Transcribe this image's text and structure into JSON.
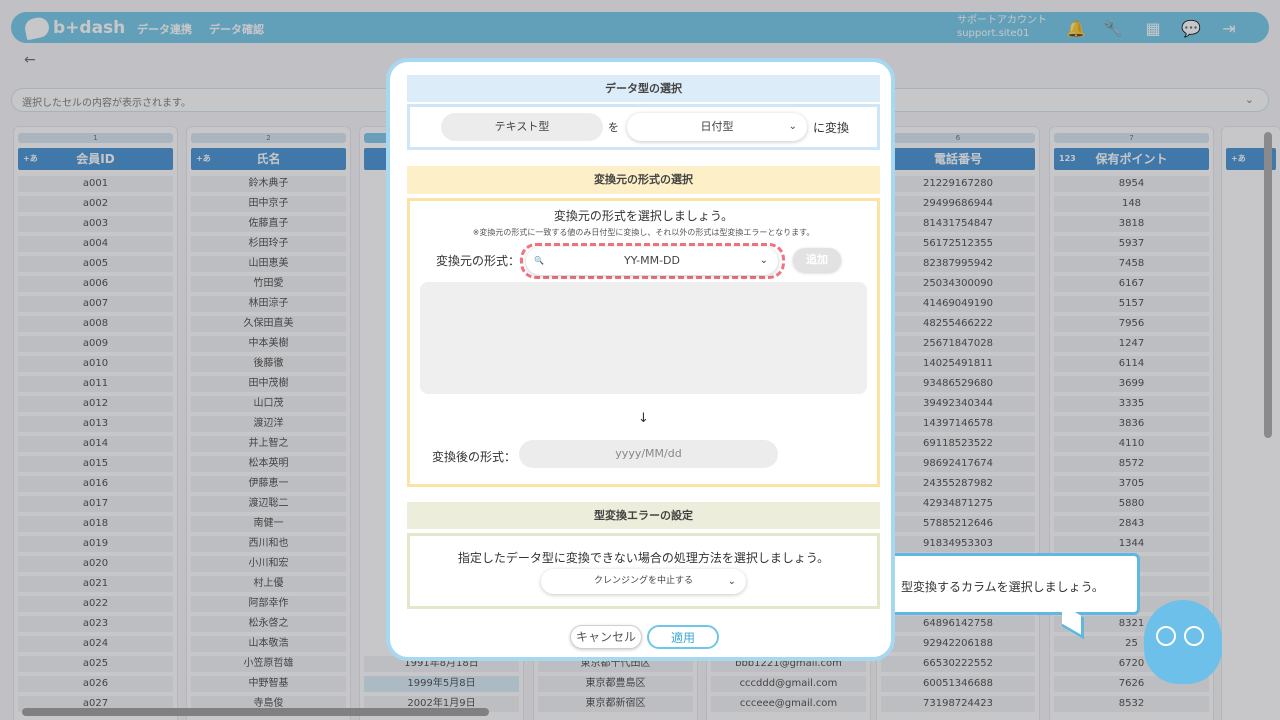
{
  "header": {
    "logo": "b+dash",
    "nav": [
      "データ連携",
      "データ確認"
    ],
    "account_name": "サポートアカウント",
    "account_id": "support.site01"
  },
  "selection_bar": {
    "placeholder": "選択したセルの内容が表示されます。"
  },
  "columns": [
    {
      "index": "1",
      "title": "会員ID",
      "type_icon": "+あ",
      "cells": [
        "a001",
        "a002",
        "a003",
        "a004",
        "a005",
        "a006",
        "a007",
        "a008",
        "a009",
        "a010",
        "a011",
        "a012",
        "a013",
        "a014",
        "a015",
        "a016",
        "a017",
        "a018",
        "a019",
        "a020",
        "a021",
        "a022",
        "a023",
        "a024",
        "a025",
        "a026",
        "a027"
      ]
    },
    {
      "index": "2",
      "title": "氏名",
      "type_icon": "+あ",
      "cells": [
        "鈴木典子",
        "田中京子",
        "佐藤直子",
        "杉田玲子",
        "山田恵美",
        "竹田愛",
        "林田涼子",
        "久保田直美",
        "中本美樹",
        "後藤徹",
        "田中茂樹",
        "山口茂",
        "渡辺洋",
        "井上智之",
        "松本英明",
        "伊藤恵一",
        "渡辺聡二",
        "南健一",
        "西川和也",
        "小川和宏",
        "村上優",
        "阿部幸作",
        "松永啓之",
        "山本敬浩",
        "小笠原哲雄",
        "中野智基",
        "寺島俊"
      ]
    },
    {
      "index": "6",
      "title": "電話番号",
      "type_icon": "",
      "cells": [
        "21229167280",
        "29499686944",
        "81431754847",
        "56172512355",
        "82387995942",
        "25034300090",
        "41469049190",
        "48255466222",
        "25671847028",
        "14025491811",
        "93486529680",
        "39492340344",
        "14397146578",
        "69118523522",
        "98692417674",
        "24355287982",
        "42934871275",
        "57885212646",
        "91834953303",
        "",
        "",
        "",
        "64896142758",
        "92942206188",
        "66530222552",
        "60051346688",
        "73198724423"
      ]
    },
    {
      "index": "7",
      "title": "保有ポイント",
      "type_icon": "123",
      "cells": [
        "8954",
        "148",
        "3818",
        "5937",
        "7458",
        "6167",
        "5157",
        "7956",
        "1247",
        "6114",
        "3699",
        "3335",
        "3836",
        "4110",
        "8572",
        "3705",
        "5880",
        "2843",
        "1344",
        "",
        "",
        "",
        "8321",
        "25",
        "6720",
        "7626",
        "8532"
      ]
    }
  ],
  "hidden_partial": {
    "col3_rows": [
      "1991年8月18日",
      "1999年5月8日",
      "2002年1月9日"
    ],
    "col4_rows": [
      "東京都千代田区",
      "東京都豊島区",
      "東京都新宿区"
    ],
    "col5_rows": [
      "bbb1221@gmail.com",
      "cccddd@gmail.com",
      "ccceee@gmail.com"
    ]
  },
  "hint": {
    "text": "型変換するカラムを選択しましょう。"
  },
  "modal": {
    "sec1": {
      "title": "データ型の選択",
      "from": "テキスト型",
      "particle": "を",
      "to": "日付型",
      "suffix": "に変換"
    },
    "sec2": {
      "title": "変換元の形式の選択",
      "lead": "変換元の形式を選択しましょう。",
      "note": "※変換元の形式に一致する値のみ日付型に変換し、それ以外の形式は型変換エラーとなります。",
      "source_label": "変換元の形式：",
      "source_value": "YY-MM-DD",
      "add": "追加",
      "arrow": "↓",
      "target_label": "変換後の形式：",
      "target_value": "yyyy/MM/dd"
    },
    "sec3": {
      "title": "型変換エラーの設定",
      "lead": "指定したデータ型に変換できない場合の処理方法を選択しましょう。",
      "option": "クレンジングを中止する"
    },
    "cancel": "キャンセル",
    "apply": "適用"
  },
  "colors": {
    "accent": "#6fc7e8",
    "header_blue": "#3e8fd1",
    "highlight": "#f07380",
    "yellow": "#fdefc8",
    "green": "#eceedb"
  }
}
